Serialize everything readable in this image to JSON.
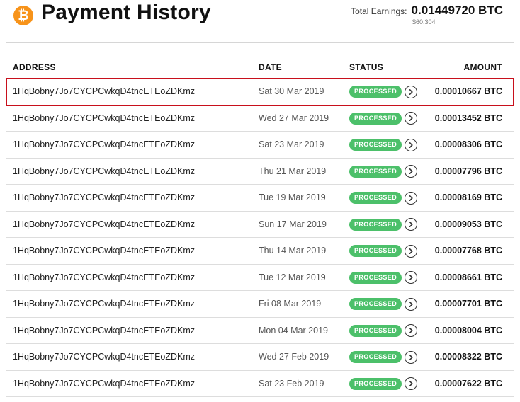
{
  "header": {
    "title": "Payment History",
    "logo_glyph": "₿",
    "logo_icon": "bitcoin-icon",
    "accent_color": "#f7931a",
    "total_earnings_label": "Total Earnings:",
    "total_earnings_value": "0.01449720 BTC",
    "total_earnings_usd": "$60.304"
  },
  "table": {
    "columns": {
      "address": "ADDRESS",
      "date": "DATE",
      "status": "STATUS",
      "amount": "AMOUNT"
    },
    "status_color": "#4cc06a",
    "highlight_color": "#c8101c",
    "detail_icon": "chevron-right-circle-icon",
    "rows": [
      {
        "address": "1HqBobny7Jo7CYCPCwkqD4tncETEoZDKmz",
        "date": "Sat 30 Mar 2019",
        "status": "PROCESSED",
        "amount": "0.00010667 BTC"
      },
      {
        "address": "1HqBobny7Jo7CYCPCwkqD4tncETEoZDKmz",
        "date": "Wed 27 Mar 2019",
        "status": "PROCESSED",
        "amount": "0.00013452 BTC"
      },
      {
        "address": "1HqBobny7Jo7CYCPCwkqD4tncETEoZDKmz",
        "date": "Sat 23 Mar 2019",
        "status": "PROCESSED",
        "amount": "0.00008306 BTC"
      },
      {
        "address": "1HqBobny7Jo7CYCPCwkqD4tncETEoZDKmz",
        "date": "Thu 21 Mar 2019",
        "status": "PROCESSED",
        "amount": "0.00007796 BTC"
      },
      {
        "address": "1HqBobny7Jo7CYCPCwkqD4tncETEoZDKmz",
        "date": "Tue 19 Mar 2019",
        "status": "PROCESSED",
        "amount": "0.00008169 BTC"
      },
      {
        "address": "1HqBobny7Jo7CYCPCwkqD4tncETEoZDKmz",
        "date": "Sun 17 Mar 2019",
        "status": "PROCESSED",
        "amount": "0.00009053 BTC"
      },
      {
        "address": "1HqBobny7Jo7CYCPCwkqD4tncETEoZDKmz",
        "date": "Thu 14 Mar 2019",
        "status": "PROCESSED",
        "amount": "0.00007768 BTC"
      },
      {
        "address": "1HqBobny7Jo7CYCPCwkqD4tncETEoZDKmz",
        "date": "Tue 12 Mar 2019",
        "status": "PROCESSED",
        "amount": "0.00008661 BTC"
      },
      {
        "address": "1HqBobny7Jo7CYCPCwkqD4tncETEoZDKmz",
        "date": "Fri 08 Mar 2019",
        "status": "PROCESSED",
        "amount": "0.00007701 BTC"
      },
      {
        "address": "1HqBobny7Jo7CYCPCwkqD4tncETEoZDKmz",
        "date": "Mon 04 Mar 2019",
        "status": "PROCESSED",
        "amount": "0.00008004 BTC"
      },
      {
        "address": "1HqBobny7Jo7CYCPCwkqD4tncETEoZDKmz",
        "date": "Wed 27 Feb 2019",
        "status": "PROCESSED",
        "amount": "0.00008322 BTC"
      },
      {
        "address": "1HqBobny7Jo7CYCPCwkqD4tncETEoZDKmz",
        "date": "Sat 23 Feb 2019",
        "status": "PROCESSED",
        "amount": "0.00007622 BTC"
      }
    ]
  }
}
